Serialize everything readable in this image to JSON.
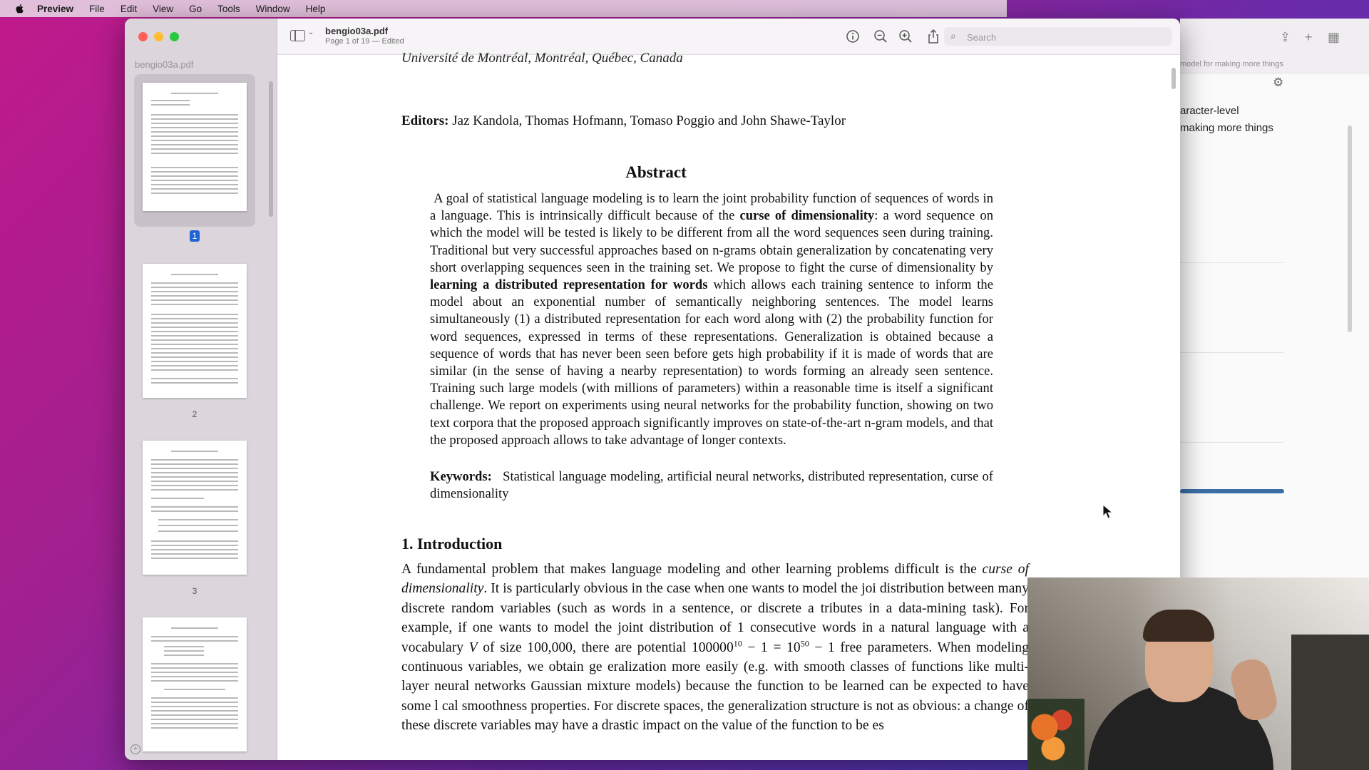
{
  "menubar": {
    "app": "Preview",
    "items": [
      "File",
      "Edit",
      "View",
      "Go",
      "Tools",
      "Window",
      "Help"
    ]
  },
  "sidebar": {
    "title": "bengio03a.pdf",
    "pages": [
      "1",
      "2",
      "3"
    ]
  },
  "toolbar": {
    "doc_title": "bengio03a.pdf",
    "doc_subtitle": "Page 1 of 19 — Edited",
    "search_placeholder": "Search",
    "icons": [
      "info-icon",
      "zoom-out-icon",
      "zoom-in-icon",
      "share-icon",
      "markup-pen-icon",
      "chevron-down-icon",
      "rotate-icon",
      "annotate-icon"
    ]
  },
  "document": {
    "cut_line": "Université de Montréal, Montréal, Québec, Canada",
    "editors_label": "Editors:",
    "editors": "Jaz Kandola, Thomas Hofmann, Tomaso Poggio and John Shawe-Taylor",
    "abstract_heading": "Abstract",
    "abstract_1": "A goal of statistical language modeling is to learn the joint probability function of sequences of words in a language. This is intrinsically difficult because of the ",
    "abstract_bold_1": "curse of dimensionality",
    "abstract_2": ": a word sequence on which the model will be tested is likely to be different from all the word sequences seen during training. Traditional but very successful approaches based on n-grams obtain generalization by concatenating very short overlapping sequences seen in the training set. We propose to fight the curse of dimensionality by ",
    "abstract_bold_2": "learning a distributed representation for words",
    "abstract_3": " which allows each training sentence to inform the model about an exponential number of semantically neighboring sentences. The model learns simultaneously (1) a distributed representation for each word along with (2) the probability function for word sequences, expressed in terms of these representations. Generalization is obtained because a sequence of words that has never been seen before gets high probability if it is made of words that are similar (in the sense of having a nearby representation) to words forming an already seen sentence. Training such large models (with millions of parameters) within a reasonable time is itself a significant challenge. We report on experiments using neural networks for the probability function, showing on two text corpora that the proposed approach significantly improves on state-of-the-art n-gram models, and that the proposed approach allows to take advantage of longer contexts.",
    "keywords_label": "Keywords:",
    "keywords": "Statistical language modeling, artificial neural networks, distributed representation, curse of dimensionality",
    "intro_heading": "1. Introduction",
    "intro_1": "A fundamental problem that makes language modeling and other learning problems difficult is the ",
    "intro_italic": "curse of dimensionality",
    "intro_2": ". It is particularly obvious in the case when one wants to model the joi distribution between many discrete random variables (such as words in a sentence, or discrete a tributes in a data-mining task). For example, if one wants to model the joint distribution of 1 consecutive words in a natural language with a vocabulary ",
    "intro_v": "V",
    "intro_3": " of size 100,000, there are potential 100000",
    "intro_sup1": "10",
    "intro_4": " − 1 = 10",
    "intro_sup2": "50",
    "intro_5": " − 1 free parameters. When modeling continuous variables, we obtain ge eralization more easily (e.g. with smooth classes of functions like multi-layer neural networks Gaussian mixture models) because the function to be learned can be expected to have some l cal smoothness properties. For discrete spaces, the generalization structure is not as obvious: a change of these discrete variables may have a drastic impact on the value of the function to be es"
  },
  "background_window": {
    "url_fragment": "model for making more things",
    "line_1": "aracter-level",
    "line_2": "making more things"
  },
  "colors": {
    "accent": "#1f64d6",
    "page_badge": "#1f64d6",
    "progress_bar": "#3a6fa5"
  }
}
